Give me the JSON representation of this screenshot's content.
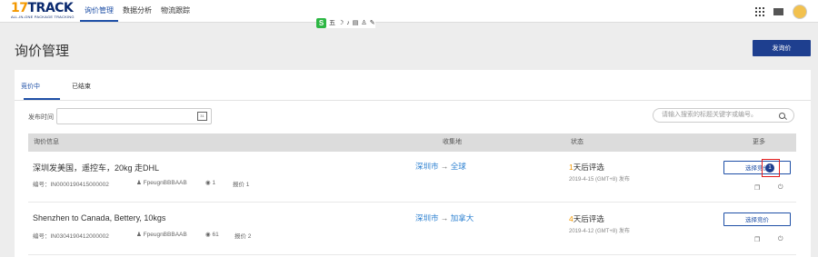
{
  "logo": {
    "main_a": "17",
    "main_b": "TRACK",
    "sub": "ALL-IN-ONE PACKAGE TRACKING"
  },
  "nav": [
    "询价管理",
    "数据分析",
    "物流跟踪"
  ],
  "extension": {
    "s": "S",
    "wu": "五"
  },
  "page": {
    "title": "询价管理",
    "primary_button": "发询价"
  },
  "tabs": [
    "竞价中",
    "已结束"
  ],
  "filters": {
    "date_label": "发布时间",
    "calendar_text": "31",
    "search_placeholder": "请输入搜索的标题关键字或编号。"
  },
  "table": {
    "headers": [
      "询价信息",
      "收集地",
      "状态",
      "更多"
    ]
  },
  "rows": [
    {
      "title": "深圳发美国，遥控车，20kg 走DHL",
      "id": "编号：IN0000190415000002",
      "user": "FpeugnBBBAAB",
      "views": "1",
      "quotes": "报价 1",
      "route_from": "深圳市",
      "route_arrow": "→",
      "route_to": "全球",
      "status_days": "1",
      "status_text": "天后评选",
      "status_date": "2019-4-15 (GMT+8) 发布",
      "button": "选择竞价",
      "badge": "1"
    },
    {
      "title": "Shenzhen to Canada, Bettery, 10kgs",
      "id": "编号：IN0304190412000002",
      "user": "FpeugnBBBAAB",
      "views": "61",
      "quotes": "报价 2",
      "route_from": "深圳市",
      "route_arrow": "→",
      "route_to": "加拿大",
      "status_days": "4",
      "status_text": "天后评选",
      "status_date": "2019-4-12 (GMT+8) 发布",
      "button": "选择竞价",
      "badge": ""
    }
  ]
}
